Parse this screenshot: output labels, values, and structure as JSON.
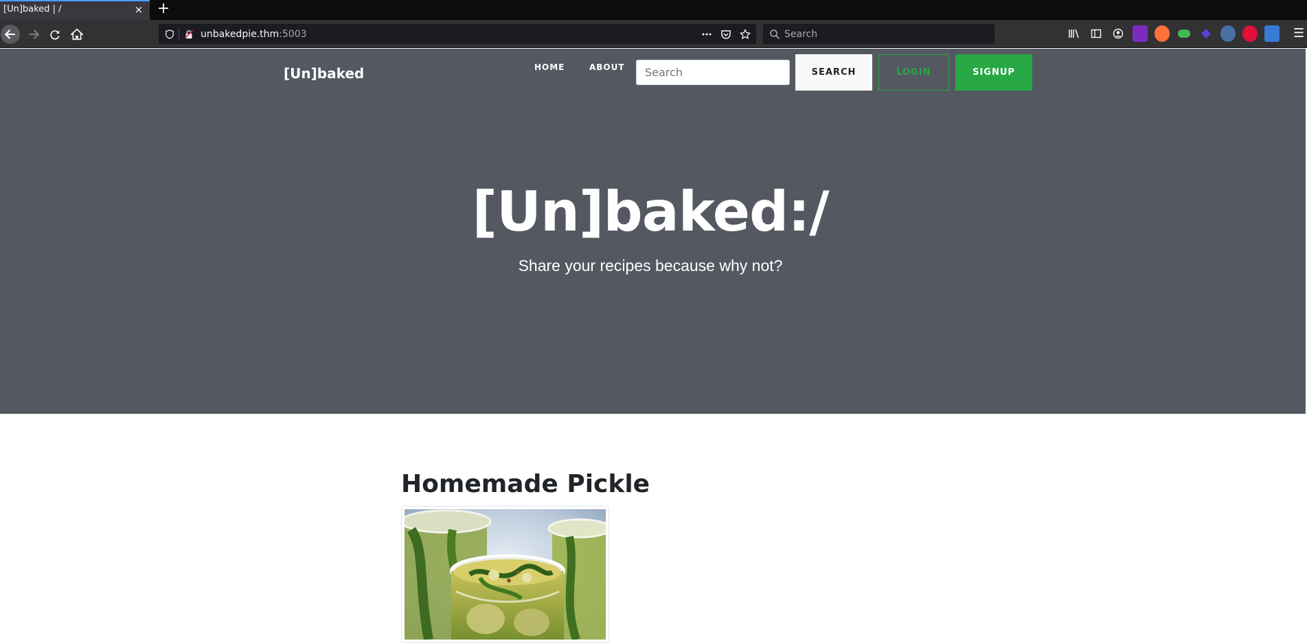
{
  "browser": {
    "tab_title": "[Un]baked | /",
    "tab_close": "×",
    "new_tab": "+",
    "url_host": "unbakedpie.thm",
    "url_port": ":5003",
    "search_placeholder": "Search",
    "menu": "☰"
  },
  "site": {
    "brand": "[Un]baked",
    "nav": {
      "home": "HOME",
      "about": "ABOUT"
    },
    "search_placeholder": "Search",
    "buttons": {
      "search": "SEARCH",
      "login": "LOGIN",
      "signup": "SIGNUP"
    },
    "accent_green": "#28a745",
    "hero_bg": "#545861"
  },
  "hero": {
    "title": "[Un]baked:/",
    "subtitle": "Share your recipes because why not?"
  },
  "posts": [
    {
      "title": "Homemade Pickle"
    }
  ]
}
